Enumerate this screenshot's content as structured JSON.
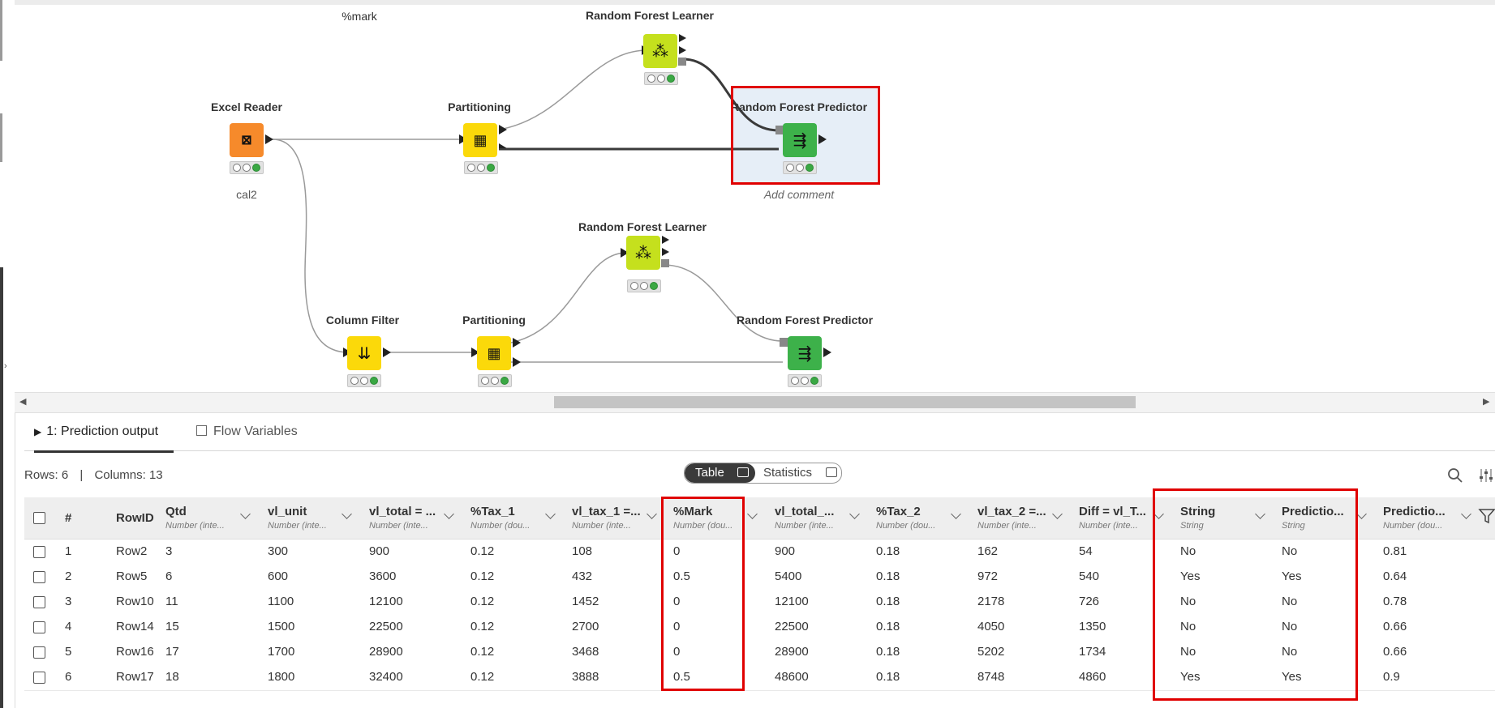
{
  "workflow": {
    "annotation": "%mark",
    "nodes": {
      "rfl_top": {
        "title": "Random Forest Learner"
      },
      "excel_reader": {
        "title": "Excel Reader",
        "comment": "cal2"
      },
      "partitioning_top": {
        "title": "Partitioning"
      },
      "rfp_top": {
        "title": "Random Forest Predictor",
        "comment": "Add comment"
      },
      "rfl_bottom": {
        "title": "Random Forest Learner"
      },
      "column_filter": {
        "title": "Column Filter"
      },
      "partitioning_bottom": {
        "title": "Partitioning"
      },
      "rfp_bottom": {
        "title": "Random Forest Predictor"
      }
    },
    "colors": {
      "learner": "#c5e01d",
      "reader": "#f68a2b",
      "partition": "#fbd90a",
      "predictor": "#3db14a",
      "selection": "#e00000"
    }
  },
  "tabs": [
    {
      "label": "1: Prediction output",
      "icon": "play-icon"
    },
    {
      "label": "Flow Variables",
      "icon": "flow-variable-icon"
    }
  ],
  "summary": {
    "rows": "Rows: 6",
    "separator": "|",
    "columns": "Columns: 13"
  },
  "view_toggle": {
    "table": "Table",
    "statistics": "Statistics"
  },
  "table": {
    "headers": [
      {
        "name": "#",
        "type": ""
      },
      {
        "name": "RowID",
        "type": ""
      },
      {
        "name": "Qtd",
        "type": "Number (inte..."
      },
      {
        "name": "vl_unit",
        "type": "Number (inte..."
      },
      {
        "name": "vl_total = ...",
        "type": "Number (inte..."
      },
      {
        "name": "%Tax_1",
        "type": "Number (dou..."
      },
      {
        "name": "vl_tax_1 =...",
        "type": "Number (inte..."
      },
      {
        "name": "%Mark",
        "type": "Number (dou..."
      },
      {
        "name": "vl_total_...",
        "type": "Number (inte..."
      },
      {
        "name": "%Tax_2",
        "type": "Number (dou..."
      },
      {
        "name": "vl_tax_2 =...",
        "type": "Number (inte..."
      },
      {
        "name": "Diff = vl_T...",
        "type": "Number (inte..."
      },
      {
        "name": "String",
        "type": "String"
      },
      {
        "name": "Predictio...",
        "type": "String"
      },
      {
        "name": "Predictio...",
        "type": "Number (dou..."
      }
    ],
    "rows": [
      [
        "1",
        "Row2",
        "3",
        "300",
        "900",
        "0.12",
        "108",
        "0",
        "900",
        "0.18",
        "162",
        "54",
        "No",
        "No",
        "0.81"
      ],
      [
        "2",
        "Row5",
        "6",
        "600",
        "3600",
        "0.12",
        "432",
        "0.5",
        "5400",
        "0.18",
        "972",
        "540",
        "Yes",
        "Yes",
        "0.64"
      ],
      [
        "3",
        "Row10",
        "11",
        "1100",
        "12100",
        "0.12",
        "1452",
        "0",
        "12100",
        "0.18",
        "2178",
        "726",
        "No",
        "No",
        "0.78"
      ],
      [
        "4",
        "Row14",
        "15",
        "1500",
        "22500",
        "0.12",
        "2700",
        "0",
        "22500",
        "0.18",
        "4050",
        "1350",
        "No",
        "No",
        "0.66"
      ],
      [
        "5",
        "Row16",
        "17",
        "1700",
        "28900",
        "0.12",
        "3468",
        "0",
        "28900",
        "0.18",
        "5202",
        "1734",
        "No",
        "No",
        "0.66"
      ],
      [
        "6",
        "Row17",
        "18",
        "1800",
        "32400",
        "0.12",
        "3888",
        "0.5",
        "48600",
        "0.18",
        "8748",
        "4860",
        "Yes",
        "Yes",
        "0.9"
      ]
    ]
  }
}
